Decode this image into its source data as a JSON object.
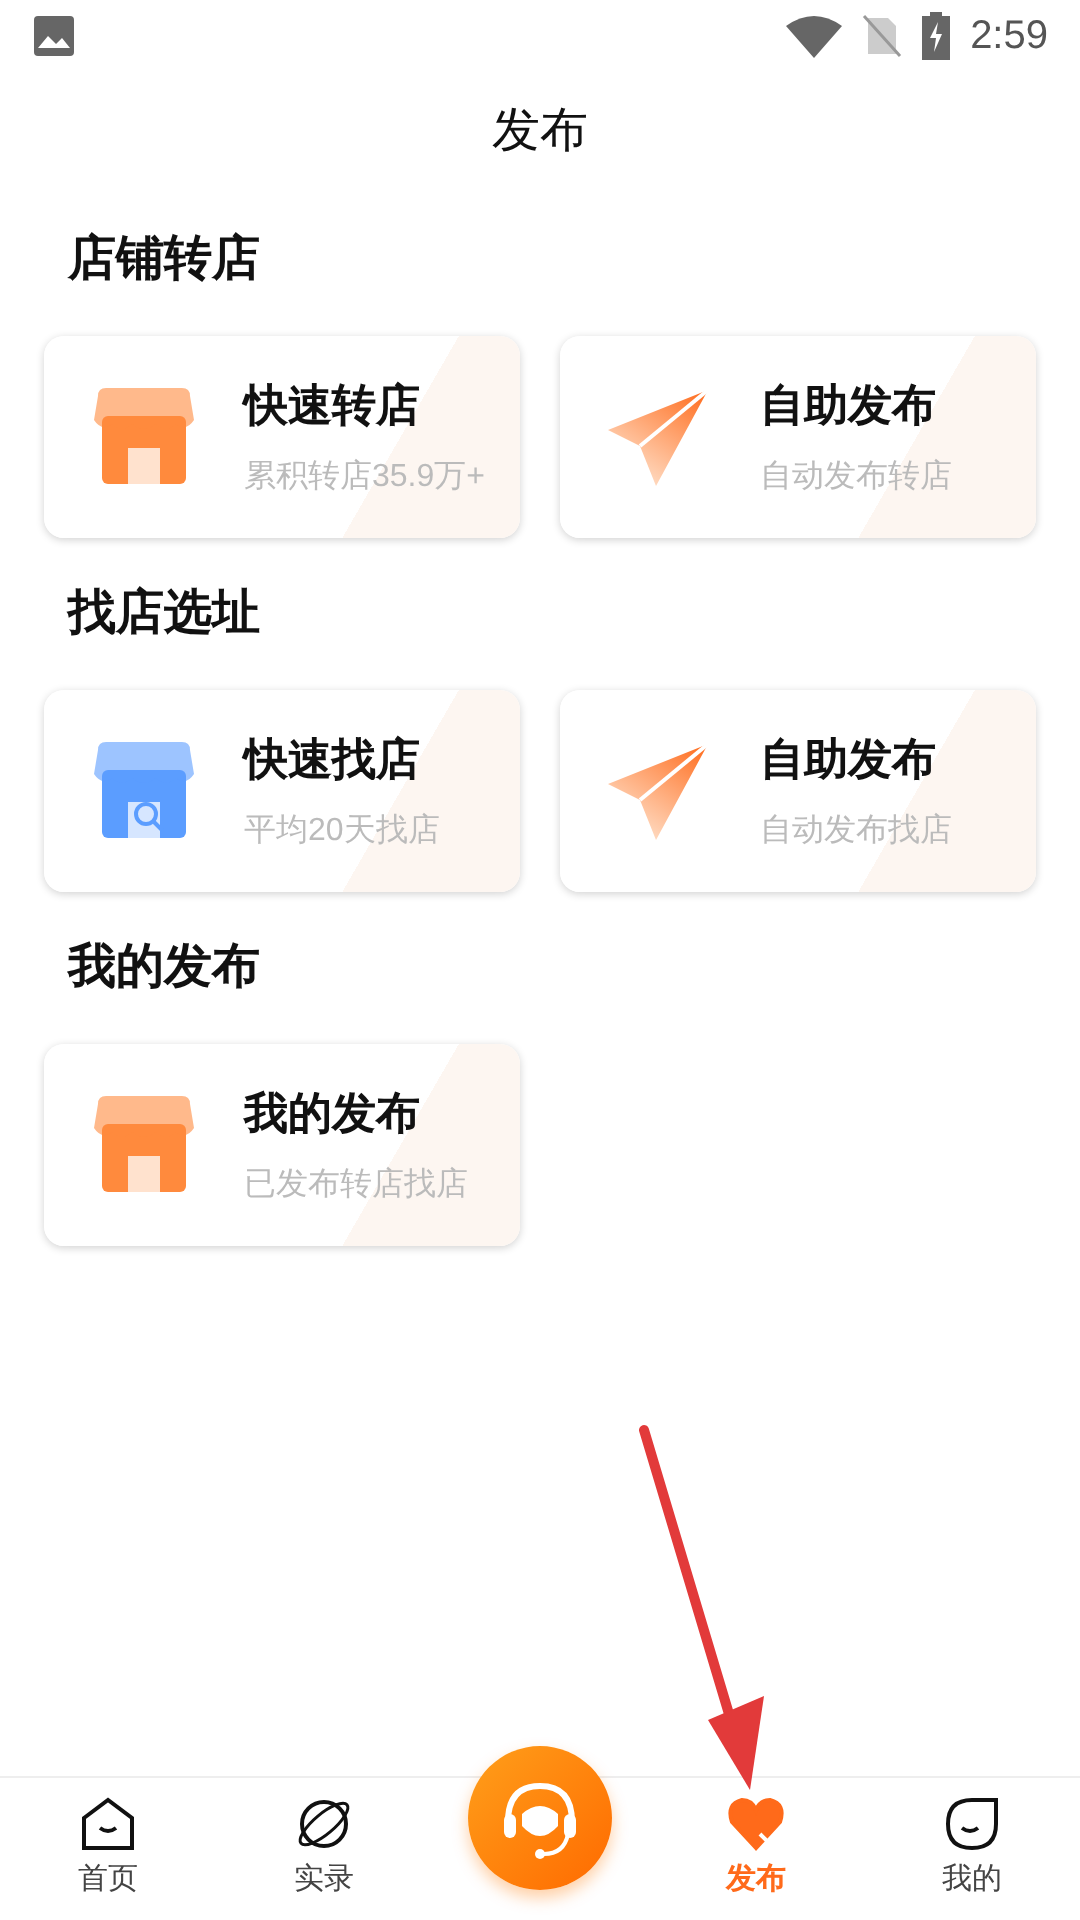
{
  "status_bar": {
    "time": "2:59"
  },
  "header": {
    "title": "发布"
  },
  "sections": [
    {
      "title": "店铺转店",
      "cards": [
        {
          "kind": "shop",
          "title": "快速转店",
          "subtitle": "累积转店35.9万+"
        },
        {
          "kind": "plane",
          "title": "自助发布",
          "subtitle": "自动发布转店"
        }
      ]
    },
    {
      "title": "找店选址",
      "cards": [
        {
          "kind": "search-shop",
          "title": "快速找店",
          "subtitle": "平均20天找店"
        },
        {
          "kind": "plane",
          "title": "自助发布",
          "subtitle": "自动发布找店"
        }
      ]
    },
    {
      "title": "我的发布",
      "cards": [
        {
          "kind": "shop",
          "title": "我的发布",
          "subtitle": "已发布转店找店"
        }
      ]
    }
  ],
  "tab_bar": {
    "items": [
      {
        "kind": "home",
        "label": "首页",
        "selected": false
      },
      {
        "kind": "planet",
        "label": "实录",
        "selected": false
      },
      {
        "kind": "center"
      },
      {
        "kind": "heart",
        "label": "发布",
        "selected": true
      },
      {
        "kind": "face",
        "label": "我的",
        "selected": false
      }
    ]
  },
  "annotation": {
    "kind": "arrow"
  }
}
